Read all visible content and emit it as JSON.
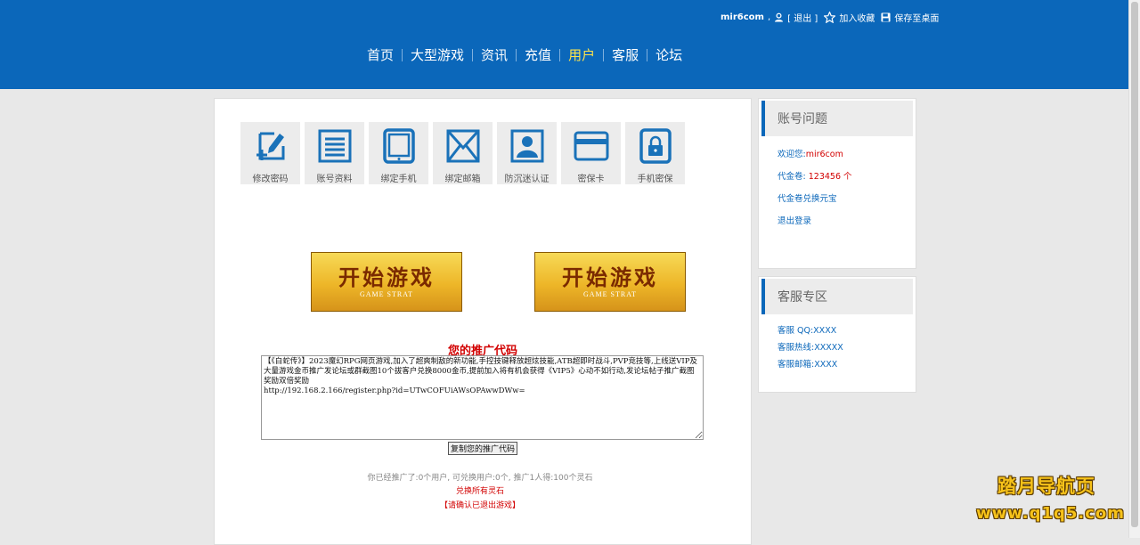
{
  "header": {
    "username": "mir6com",
    "comma": ",",
    "logout_label": "[ 退出 ]",
    "favorite_label": "加入收藏",
    "save_desktop_label": "保存至桌面"
  },
  "nav": {
    "items": [
      "首页",
      "大型游戏",
      "资讯",
      "充值",
      "用户",
      "客服",
      "论坛"
    ],
    "active": "用户"
  },
  "tools": [
    {
      "label": "修改密码",
      "icon": "edit-password-icon"
    },
    {
      "label": "账号资料",
      "icon": "document-icon"
    },
    {
      "label": "绑定手机",
      "icon": "tablet-icon"
    },
    {
      "label": "绑定邮箱",
      "icon": "envelope-icon"
    },
    {
      "label": "防沉迷认证",
      "icon": "id-card-icon"
    },
    {
      "label": "密保卡",
      "icon": "card-icon"
    },
    {
      "label": "手机密保",
      "icon": "phone-lock-icon"
    }
  ],
  "start_buttons": [
    {
      "title": "开始游戏",
      "subtitle": "GAME STRAT"
    },
    {
      "title": "开始游戏",
      "subtitle": "GAME STRAT"
    }
  ],
  "promo": {
    "title": "您的推广代码",
    "text": "【《白蛇传》】2023魔幻RPG网页游戏,加入了超爽制敌的新功能,手控技键释放超炫技能,ATB超即时战斗,PVP竞技等,上线送VIP及大量游戏金币推广发论坛或群截图10个拔客户兑换8000金币,提前加入将有机会获得《VIP5》心动不如行动,发论坛帖子推广截图奖励双倍奖励\nhttp://192.168.2.166/register.php?id=UTwCOFUiAWsOPAwwDWw=",
    "copy_button": "复制您的推广代码",
    "stats": "你已经推广了:0个用户, 可兑换用户:0个, 推广1人得:100个灵石",
    "exchange_link": "兑换所有灵石",
    "confirm_note": "【请确认已退出游戏】"
  },
  "account_box": {
    "title": "账号问题",
    "welcome_prefix": "欢迎您:",
    "welcome_user": "mir6com",
    "voucher_prefix": "代金卷: ",
    "voucher_value": "123456 个",
    "exchange": "代金卷兑换元宝",
    "logout": "退出登录"
  },
  "service_box": {
    "title": "客服专区",
    "items": [
      "客服 QQ:XXXX",
      "客服热线:XXXXX",
      "客服邮箱:XXXX"
    ]
  },
  "watermark": {
    "line1": "踏月导航页",
    "line2": "www.q1q5.com"
  },
  "colors": {
    "header_bg": "#0b67ba",
    "nav_active": "#ffe44a",
    "accent_red": "#d20000"
  }
}
